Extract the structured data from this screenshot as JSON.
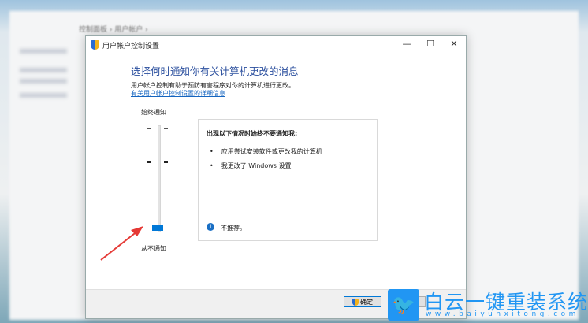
{
  "background": {
    "breadcrumb": "控制面板 › 用户帐户 ›"
  },
  "dialog": {
    "title": "用户帐户控制设置",
    "heading": "选择何时通知你有关计算机更改的消息",
    "description": "用户帐户控制有助于预防有害程序对你的计算机进行更改。",
    "link": "有关用户帐户控制设置的详细信息",
    "slider": {
      "top_label": "始终通知",
      "bottom_label": "从不通知",
      "levels": 4,
      "current_level": 1
    },
    "info": {
      "title": "出现以下情况时始终不要通知我:",
      "items": [
        "应用尝试安装软件或更改我的计算机",
        "我更改了 Windows 设置"
      ],
      "note": "不推荐。"
    },
    "buttons": {
      "ok": "确定"
    }
  },
  "watermark": {
    "title": "白云一键重装系统",
    "url": "www.baiyunxitong.com"
  },
  "colors": {
    "accent": "#0078d7",
    "heading": "#2b4f9e",
    "watermark": "#2196f3",
    "arrow": "#e53935"
  }
}
